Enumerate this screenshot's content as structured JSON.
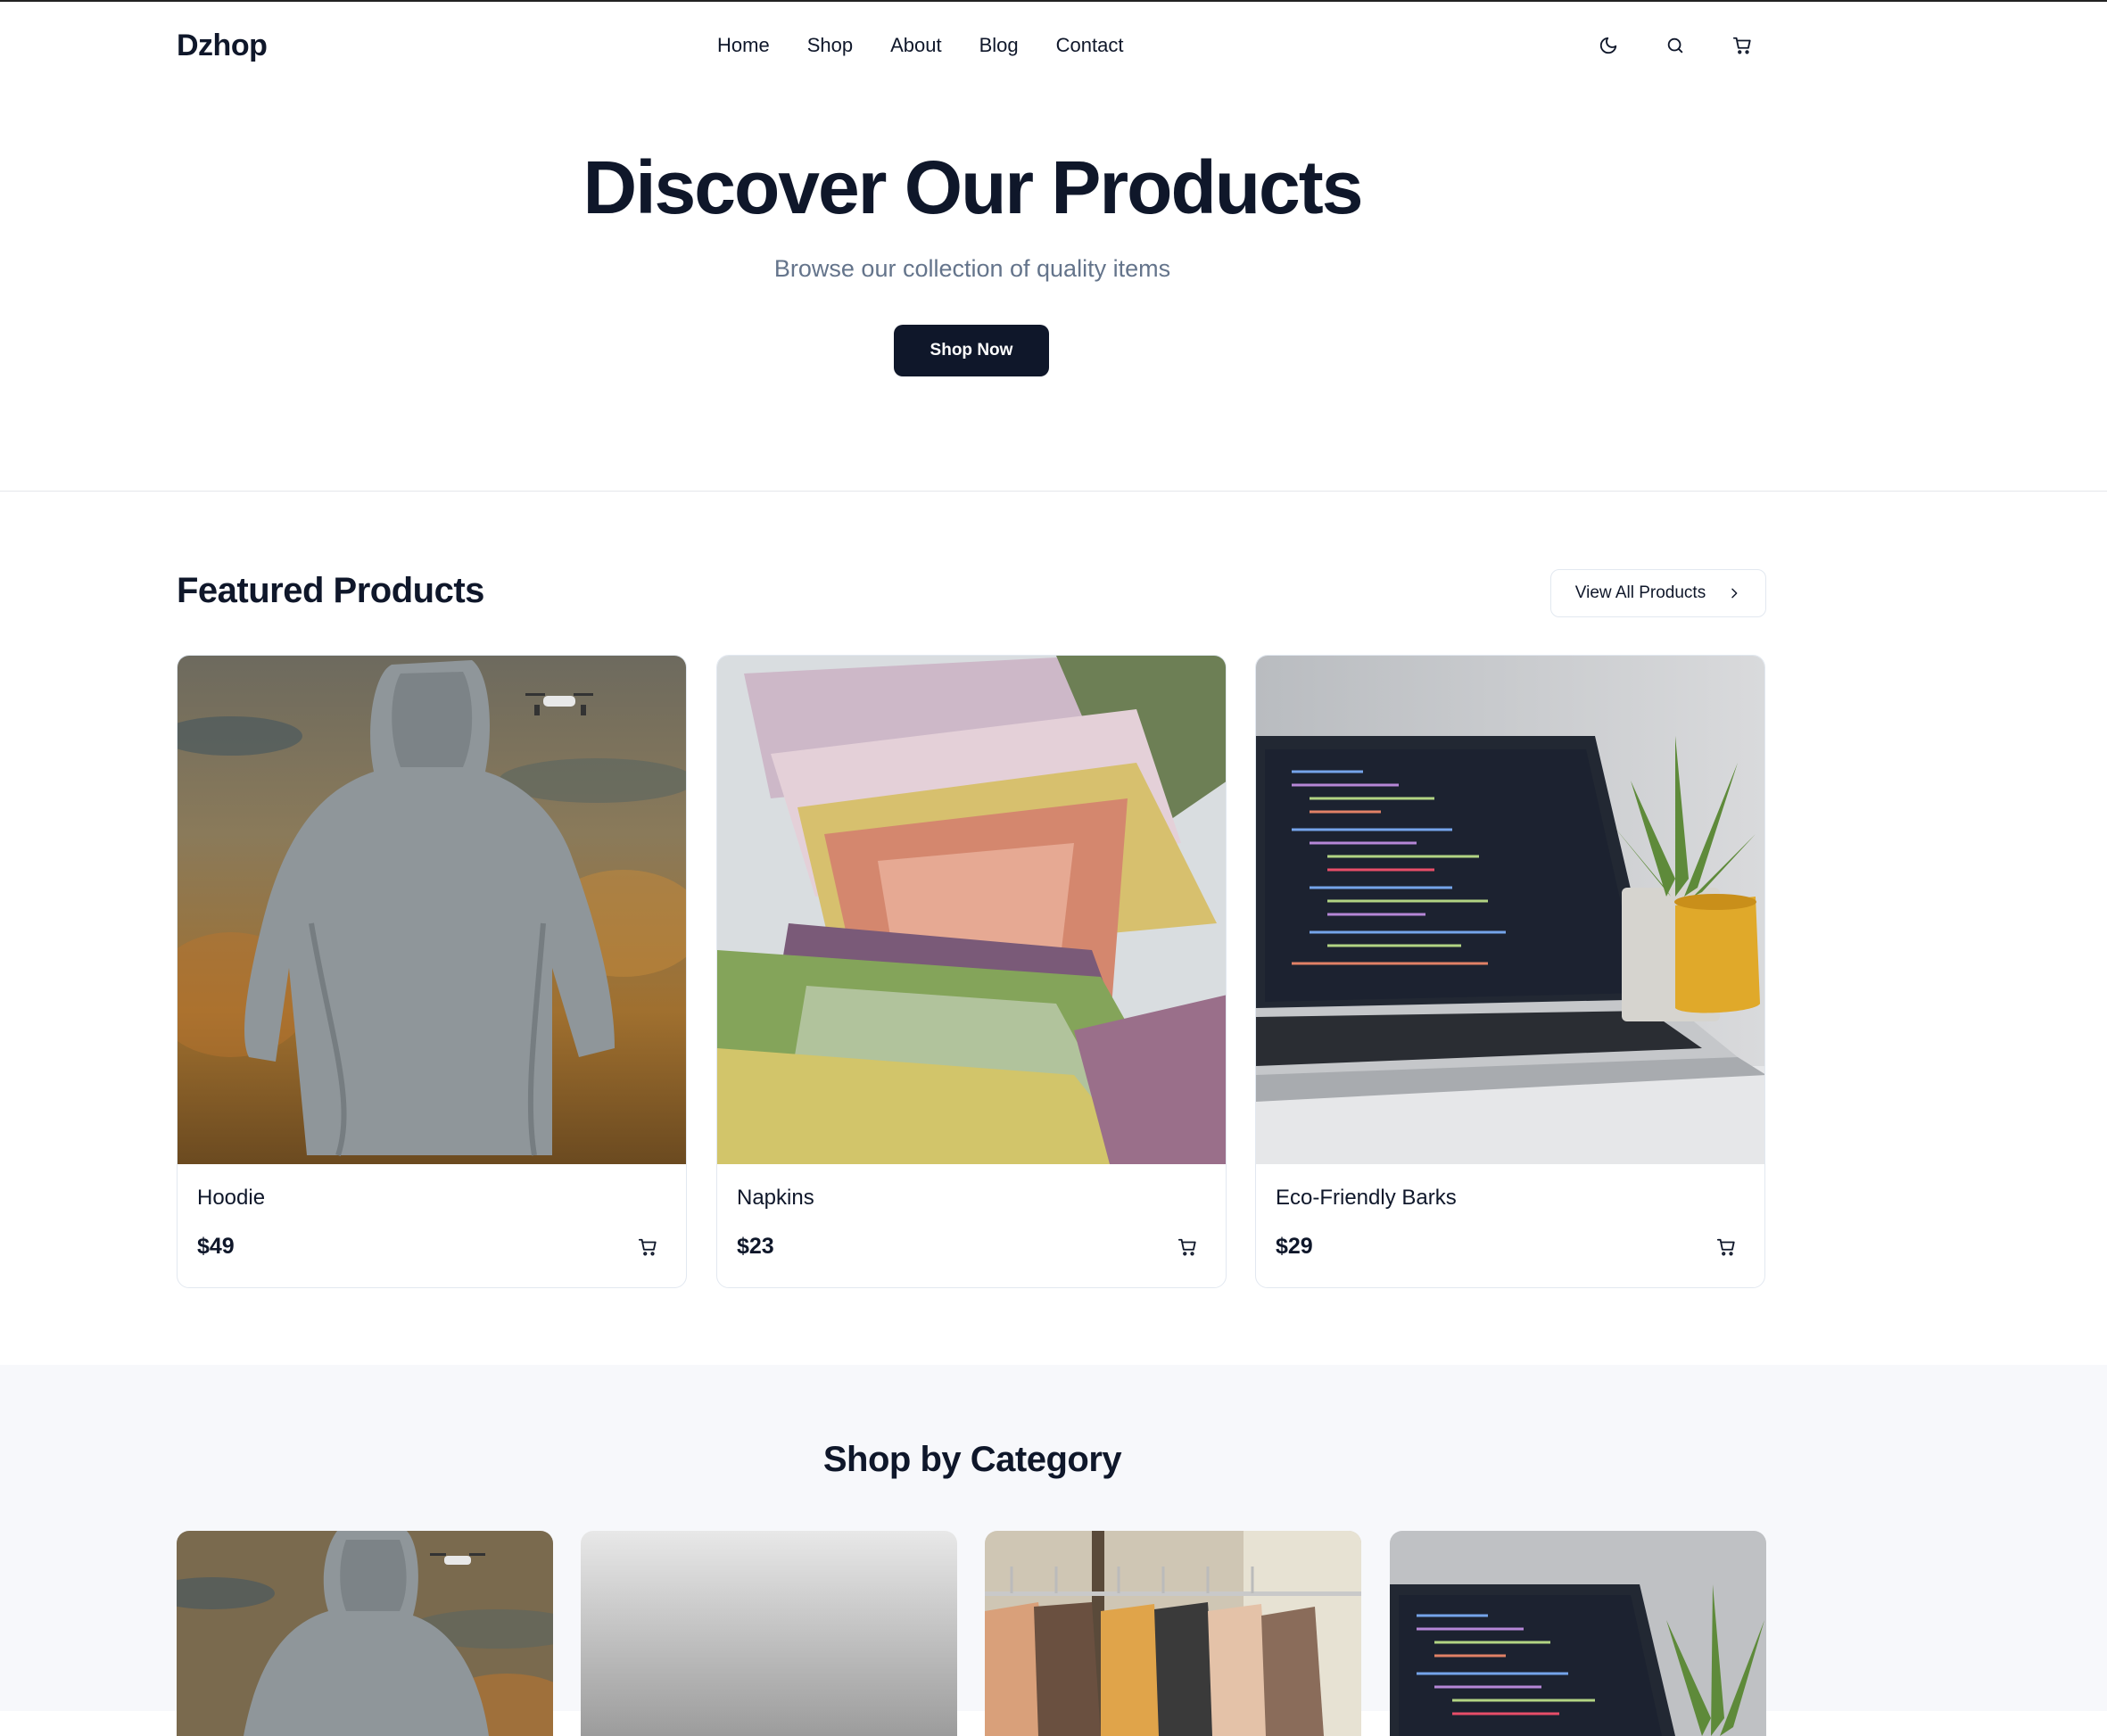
{
  "header": {
    "logo": "Dzhop",
    "nav": [
      "Home",
      "Shop",
      "About",
      "Blog",
      "Contact"
    ],
    "icons": [
      "moon-icon",
      "search-icon",
      "cart-icon"
    ]
  },
  "hero": {
    "title": "Discover Our Products",
    "subtitle": "Browse our collection of quality items",
    "cta": "Shop Now"
  },
  "featured": {
    "title": "Featured Products",
    "view_all": "View All Products",
    "products": [
      {
        "name": "Hoodie",
        "price": "$49"
      },
      {
        "name": "Napkins",
        "price": "$23"
      },
      {
        "name": "Eco-Friendly Barks",
        "price": "$29"
      }
    ]
  },
  "categories": {
    "title": "Shop by Category"
  },
  "colors": {
    "primary": "#0f172a",
    "muted": "#64748b",
    "border": "#e2e8f0",
    "section_bg": "#f7f8fb"
  }
}
